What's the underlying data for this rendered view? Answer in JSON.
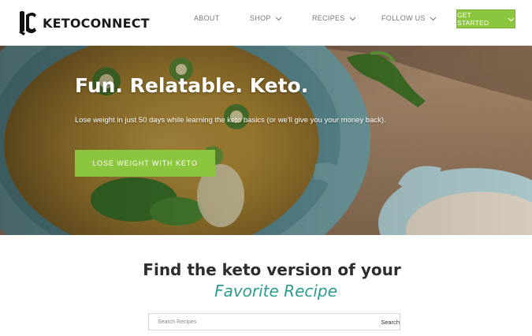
{
  "header": {
    "brand": "KETOCONNECT",
    "nav": [
      {
        "label": "ABOUT",
        "has_dropdown": false
      },
      {
        "label": "SHOP",
        "has_dropdown": true
      },
      {
        "label": "RECIPES",
        "has_dropdown": true
      },
      {
        "label": "FOLLOW US",
        "has_dropdown": true
      }
    ],
    "cta_label": "GET STARTED"
  },
  "hero": {
    "title": "Fun. Relatable. Keto.",
    "subtitle": "Lose weight in just 50 days while learning the keto basics (or we'll give you your money back).",
    "button_label": "LOSE WEIGHT WITH KETO"
  },
  "find": {
    "title": "Find the keto version of your",
    "subtitle": "Favorite Recipe",
    "search_placeholder": "Search Recipes",
    "search_button": "Search"
  },
  "colors": {
    "accent_green": "#8cc63f",
    "teal": "#2a9d8f"
  }
}
